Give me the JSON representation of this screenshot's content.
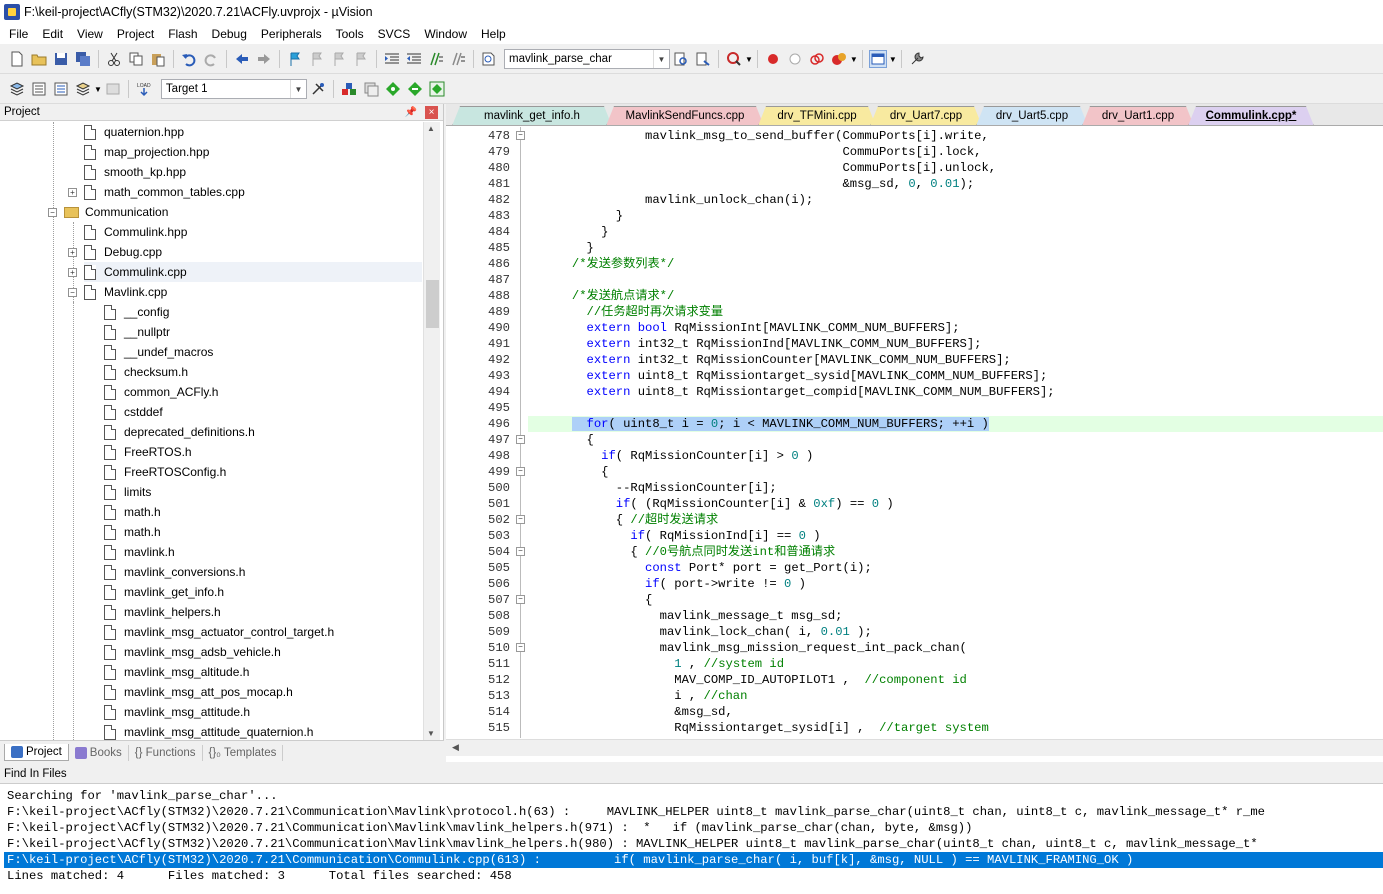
{
  "window": {
    "title": "F:\\keil-project\\ACfly(STM32)\\2020.7.21\\ACFly.uvprojx - µVision"
  },
  "menu": [
    "File",
    "Edit",
    "View",
    "Project",
    "Flash",
    "Debug",
    "Peripherals",
    "Tools",
    "SVCS",
    "Window",
    "Help"
  ],
  "toolbar": {
    "find_combo": "mavlink_parse_char",
    "target_combo": "Target 1"
  },
  "project_panel": {
    "title": "Project",
    "tree": [
      {
        "label": "quaternion.hpp",
        "type": "file",
        "indent": 3,
        "expander": ""
      },
      {
        "label": "map_projection.hpp",
        "type": "file",
        "indent": 3,
        "expander": ""
      },
      {
        "label": "smooth_kp.hpp",
        "type": "file",
        "indent": 3,
        "expander": ""
      },
      {
        "label": "math_common_tables.cpp",
        "type": "file",
        "indent": 3,
        "expander": "+"
      },
      {
        "label": "Communication",
        "type": "folder",
        "indent": 2,
        "expander": "-"
      },
      {
        "label": "Commulink.hpp",
        "type": "file",
        "indent": 3,
        "expander": ""
      },
      {
        "label": "Debug.cpp",
        "type": "file",
        "indent": 3,
        "expander": "+"
      },
      {
        "label": "Commulink.cpp",
        "type": "file",
        "indent": 3,
        "expander": "+"
      },
      {
        "label": "Mavlink.cpp",
        "type": "file",
        "indent": 3,
        "expander": "-"
      },
      {
        "label": "__config",
        "type": "file",
        "indent": 4,
        "expander": ""
      },
      {
        "label": "__nullptr",
        "type": "file",
        "indent": 4,
        "expander": ""
      },
      {
        "label": "__undef_macros",
        "type": "file",
        "indent": 4,
        "expander": ""
      },
      {
        "label": "checksum.h",
        "type": "file",
        "indent": 4,
        "expander": ""
      },
      {
        "label": "common_ACFly.h",
        "type": "file",
        "indent": 4,
        "expander": ""
      },
      {
        "label": "cstddef",
        "type": "file",
        "indent": 4,
        "expander": ""
      },
      {
        "label": "deprecated_definitions.h",
        "type": "file",
        "indent": 4,
        "expander": ""
      },
      {
        "label": "FreeRTOS.h",
        "type": "file",
        "indent": 4,
        "expander": ""
      },
      {
        "label": "FreeRTOSConfig.h",
        "type": "file",
        "indent": 4,
        "expander": ""
      },
      {
        "label": "limits",
        "type": "file",
        "indent": 4,
        "expander": ""
      },
      {
        "label": "math.h",
        "type": "file",
        "indent": 4,
        "expander": ""
      },
      {
        "label": "math.h",
        "type": "file",
        "indent": 4,
        "expander": ""
      },
      {
        "label": "mavlink.h",
        "type": "file",
        "indent": 4,
        "expander": ""
      },
      {
        "label": "mavlink_conversions.h",
        "type": "file",
        "indent": 4,
        "expander": ""
      },
      {
        "label": "mavlink_get_info.h",
        "type": "file",
        "indent": 4,
        "expander": ""
      },
      {
        "label": "mavlink_helpers.h",
        "type": "file",
        "indent": 4,
        "expander": ""
      },
      {
        "label": "mavlink_msg_actuator_control_target.h",
        "type": "file",
        "indent": 4,
        "expander": ""
      },
      {
        "label": "mavlink_msg_adsb_vehicle.h",
        "type": "file",
        "indent": 4,
        "expander": ""
      },
      {
        "label": "mavlink_msg_altitude.h",
        "type": "file",
        "indent": 4,
        "expander": ""
      },
      {
        "label": "mavlink_msg_att_pos_mocap.h",
        "type": "file",
        "indent": 4,
        "expander": ""
      },
      {
        "label": "mavlink_msg_attitude.h",
        "type": "file",
        "indent": 4,
        "expander": ""
      },
      {
        "label": "mavlink_msg_attitude_quaternion.h",
        "type": "file",
        "indent": 4,
        "expander": ""
      }
    ],
    "tabs": [
      {
        "label": "Project",
        "color": "#3a6fc4",
        "active": true
      },
      {
        "label": "Books",
        "color": "#8a7ad0",
        "active": false
      },
      {
        "label": "{} Functions",
        "color": "",
        "active": false
      },
      {
        "label": "{}₀ Templates",
        "color": "",
        "active": false
      }
    ]
  },
  "editor": {
    "tabs": [
      {
        "label": "mavlink_get_info.h",
        "color": "#c8e6e0"
      },
      {
        "label": "MavlinkSendFuncs.cpp",
        "color": "#f2c4c8"
      },
      {
        "label": "drv_TFMini.cpp",
        "color": "#f8eaa0"
      },
      {
        "label": "drv_Uart7.cpp",
        "color": "#f8eaa0"
      },
      {
        "label": "drv_Uart5.cpp",
        "color": "#cfe4f4"
      },
      {
        "label": "drv_Uart1.cpp",
        "color": "#f2c4c8"
      },
      {
        "label": "Commulink.cpp*",
        "color": "#dcd0f0",
        "active": true
      }
    ],
    "lines": [
      {
        "n": "478",
        "fold": "-",
        "segs": [
          [
            "                mavlink_msg_to_send_buffer(CommuPorts[i].write,",
            ""
          ]
        ]
      },
      {
        "n": "479",
        "fold": "",
        "segs": [
          [
            "                                           CommuPorts[i].lock,",
            ""
          ]
        ]
      },
      {
        "n": "480",
        "fold": "",
        "segs": [
          [
            "                                           CommuPorts[i].unlock,",
            ""
          ]
        ]
      },
      {
        "n": "481",
        "fold": "",
        "segs": [
          [
            "                                           &msg_sd, ",
            ""
          ],
          [
            "0",
            "num"
          ],
          [
            ", ",
            ""
          ],
          [
            "0.01",
            "num"
          ],
          [
            ");",
            ""
          ]
        ]
      },
      {
        "n": "482",
        "fold": "",
        "segs": [
          [
            "                mavlink_unlock_chan(i);",
            ""
          ]
        ]
      },
      {
        "n": "483",
        "fold": "",
        "segs": [
          [
            "            }",
            ""
          ]
        ]
      },
      {
        "n": "484",
        "fold": "",
        "segs": [
          [
            "          }",
            ""
          ]
        ]
      },
      {
        "n": "485",
        "fold": "",
        "segs": [
          [
            "        }",
            ""
          ]
        ]
      },
      {
        "n": "486",
        "fold": "",
        "segs": [
          [
            "      ",
            ""
          ],
          [
            "/*发送参数列表*/",
            "cmt"
          ]
        ]
      },
      {
        "n": "487",
        "fold": "",
        "segs": [
          [
            "",
            ""
          ]
        ]
      },
      {
        "n": "488",
        "fold": "",
        "segs": [
          [
            "      ",
            ""
          ],
          [
            "/*发送航点请求*/",
            "cmt"
          ]
        ]
      },
      {
        "n": "489",
        "fold": "",
        "segs": [
          [
            "        ",
            ""
          ],
          [
            "//任务超时再次请求变量",
            "cmt"
          ]
        ]
      },
      {
        "n": "490",
        "fold": "",
        "segs": [
          [
            "        ",
            ""
          ],
          [
            "extern",
            "kw"
          ],
          [
            " ",
            ""
          ],
          [
            "bool",
            "kw"
          ],
          [
            " RqMissionInt[MAVLINK_COMM_NUM_BUFFERS];",
            ""
          ]
        ]
      },
      {
        "n": "491",
        "fold": "",
        "segs": [
          [
            "        ",
            ""
          ],
          [
            "extern",
            "kw"
          ],
          [
            " int32_t RqMissionInd[MAVLINK_COMM_NUM_BUFFERS];",
            ""
          ]
        ]
      },
      {
        "n": "492",
        "fold": "",
        "segs": [
          [
            "        ",
            ""
          ],
          [
            "extern",
            "kw"
          ],
          [
            " int32_t RqMissionCounter[MAVLINK_COMM_NUM_BUFFERS];",
            ""
          ]
        ]
      },
      {
        "n": "493",
        "fold": "",
        "segs": [
          [
            "        ",
            ""
          ],
          [
            "extern",
            "kw"
          ],
          [
            " uint8_t RqMissiontarget_sysid[MAVLINK_COMM_NUM_BUFFERS];",
            ""
          ]
        ]
      },
      {
        "n": "494",
        "fold": "",
        "segs": [
          [
            "        ",
            ""
          ],
          [
            "extern",
            "kw"
          ],
          [
            " uint8_t RqMissiontarget_compid[MAVLINK_COMM_NUM_BUFFERS];",
            ""
          ]
        ]
      },
      {
        "n": "495",
        "fold": "",
        "segs": [
          [
            "",
            ""
          ]
        ]
      },
      {
        "n": "496",
        "fold": "",
        "hl": true,
        "segs": [
          [
            "      ",
            ""
          ],
          [
            "  ",
            "sel"
          ],
          [
            "for",
            "kw sel"
          ],
          [
            "( uint8_t i = ",
            "sel"
          ],
          [
            "0",
            "num sel"
          ],
          [
            "; i < MAVLINK_COMM_NUM_BUFFERS; ++i )",
            "sel"
          ]
        ]
      },
      {
        "n": "497",
        "fold": "-",
        "segs": [
          [
            "        {",
            ""
          ]
        ]
      },
      {
        "n": "498",
        "fold": "",
        "segs": [
          [
            "          ",
            ""
          ],
          [
            "if",
            "kw"
          ],
          [
            "( RqMissionCounter[i] > ",
            ""
          ],
          [
            "0",
            "num"
          ],
          [
            " )",
            ""
          ]
        ]
      },
      {
        "n": "499",
        "fold": "-",
        "segs": [
          [
            "          {",
            ""
          ]
        ]
      },
      {
        "n": "500",
        "fold": "",
        "segs": [
          [
            "            --RqMissionCounter[i];",
            ""
          ]
        ]
      },
      {
        "n": "501",
        "fold": "",
        "segs": [
          [
            "            ",
            ""
          ],
          [
            "if",
            "kw"
          ],
          [
            "( (RqMissionCounter[i] & ",
            ""
          ],
          [
            "0xf",
            "num"
          ],
          [
            ") == ",
            ""
          ],
          [
            "0",
            "num"
          ],
          [
            " )",
            ""
          ]
        ]
      },
      {
        "n": "502",
        "fold": "-",
        "segs": [
          [
            "            { ",
            ""
          ],
          [
            "//超时发送请求",
            "cmt"
          ]
        ]
      },
      {
        "n": "503",
        "fold": "",
        "segs": [
          [
            "              ",
            ""
          ],
          [
            "if",
            "kw"
          ],
          [
            "( RqMissionInd[i] == ",
            ""
          ],
          [
            "0",
            "num"
          ],
          [
            " )",
            ""
          ]
        ]
      },
      {
        "n": "504",
        "fold": "-",
        "segs": [
          [
            "              { ",
            ""
          ],
          [
            "//0号航点同时发送int和普通请求",
            "cmt"
          ]
        ]
      },
      {
        "n": "505",
        "fold": "",
        "segs": [
          [
            "                ",
            ""
          ],
          [
            "const",
            "kw"
          ],
          [
            " Port* port = get_Port(i);",
            ""
          ]
        ]
      },
      {
        "n": "506",
        "fold": "",
        "segs": [
          [
            "                ",
            ""
          ],
          [
            "if",
            "kw"
          ],
          [
            "( port->write != ",
            ""
          ],
          [
            "0",
            "num"
          ],
          [
            " )",
            ""
          ]
        ]
      },
      {
        "n": "507",
        "fold": "-",
        "segs": [
          [
            "                {",
            ""
          ]
        ]
      },
      {
        "n": "508",
        "fold": "",
        "segs": [
          [
            "                  mavlink_message_t msg_sd;",
            ""
          ]
        ]
      },
      {
        "n": "509",
        "fold": "",
        "segs": [
          [
            "                  mavlink_lock_chan( i, ",
            ""
          ],
          [
            "0.01",
            "num"
          ],
          [
            " );",
            ""
          ]
        ]
      },
      {
        "n": "510",
        "fold": "-",
        "segs": [
          [
            "                  mavlink_msg_mission_request_int_pack_chan(",
            ""
          ]
        ]
      },
      {
        "n": "511",
        "fold": "",
        "segs": [
          [
            "                    ",
            ""
          ],
          [
            "1",
            "num"
          ],
          [
            " , ",
            ""
          ],
          [
            "//system id",
            "cmt"
          ]
        ]
      },
      {
        "n": "512",
        "fold": "",
        "segs": [
          [
            "                    MAV_COMP_ID_AUTOPILOT1 ,  ",
            ""
          ],
          [
            "//component id",
            "cmt"
          ]
        ]
      },
      {
        "n": "513",
        "fold": "",
        "segs": [
          [
            "                    i , ",
            ""
          ],
          [
            "//chan",
            "cmt"
          ]
        ]
      },
      {
        "n": "514",
        "fold": "",
        "segs": [
          [
            "                    &msg_sd,",
            ""
          ]
        ]
      },
      {
        "n": "515",
        "fold": "",
        "segs": [
          [
            "                    RqMissiontarget_sysid[i] ,  ",
            ""
          ],
          [
            "//target system",
            "cmt"
          ]
        ]
      }
    ]
  },
  "find_panel": {
    "title": "Find In Files",
    "lines": [
      {
        "text": "Searching for 'mavlink_parse_char'...",
        "selected": false
      },
      {
        "text": "F:\\keil-project\\ACfly(STM32)\\2020.7.21\\Communication\\Mavlink\\protocol.h(63) :     MAVLINK_HELPER uint8_t mavlink_parse_char(uint8_t chan, uint8_t c, mavlink_message_t* r_me",
        "selected": false
      },
      {
        "text": "F:\\keil-project\\ACfly(STM32)\\2020.7.21\\Communication\\Mavlink\\mavlink_helpers.h(971) :  *   if (mavlink_parse_char(chan, byte, &msg))",
        "selected": false
      },
      {
        "text": "F:\\keil-project\\ACfly(STM32)\\2020.7.21\\Communication\\Mavlink\\mavlink_helpers.h(980) : MAVLINK_HELPER uint8_t mavlink_parse_char(uint8_t chan, uint8_t c, mavlink_message_t*",
        "selected": false
      },
      {
        "text": "F:\\keil-project\\ACfly(STM32)\\2020.7.21\\Communication\\Commulink.cpp(613) :          if( mavlink_parse_char( i, buf[k], &msg, NULL ) == MAVLINK_FRAMING_OK )",
        "selected": true
      },
      {
        "text": "Lines matched: 4      Files matched: 3      Total files searched: 458",
        "selected": false
      }
    ]
  }
}
